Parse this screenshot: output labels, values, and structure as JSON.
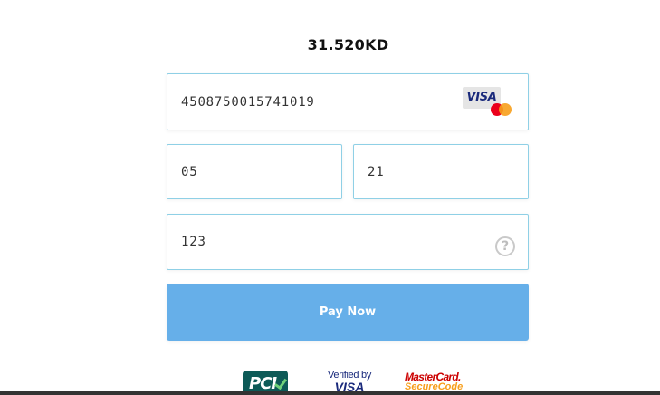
{
  "payment": {
    "amount": "31.520KD",
    "card_number": "4508750015741019",
    "expiry_month": "05",
    "expiry_year": "21",
    "cvv": "123",
    "pay_label": "Pay Now",
    "help_glyph": "?"
  },
  "card_brands": {
    "visa_label": "VISA",
    "mastercard_icon": "mastercard-circles"
  },
  "security_logos": {
    "pci_label": "PCI",
    "verified_by_visa_line1": "Verified by",
    "verified_by_visa_line2": "VISA",
    "mastercard_securecode_line1": "MasterCard.",
    "mastercard_securecode_line2": "SecureCode"
  },
  "colors": {
    "button": "#66afe9",
    "field_border": "#8fd0e6",
    "mastercard_red": "#eb001b",
    "mastercard_orange": "#f79e1b",
    "visa_blue": "#1a2a7c",
    "pci_teal": "#0d5a57"
  }
}
